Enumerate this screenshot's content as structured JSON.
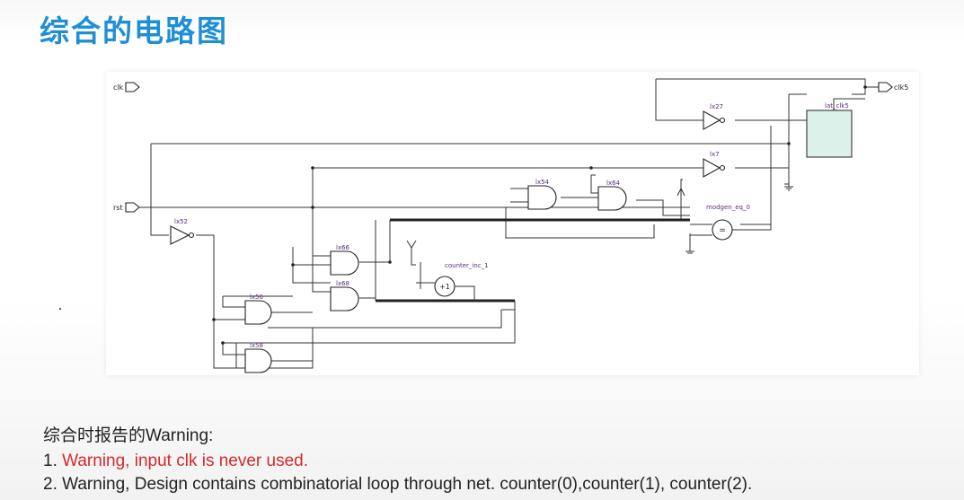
{
  "title": "综合的电路图",
  "diagram": {
    "ports": {
      "clk": "clk",
      "rst": "rst",
      "clk5": "clk5"
    },
    "instances": {
      "Ix27": "lx27",
      "Ix7": "lx7",
      "Ix52": "lx52",
      "Ix54": "lx54",
      "Ix64": "lx64",
      "Ix66": "lx66",
      "Ix68": "lx68",
      "Ix56": "lx56",
      "Ix58": "lx58",
      "lat_clk5": "lat_clk5",
      "counter_inc": "counter_inc_1",
      "modgen": "modgen_eq_0"
    },
    "symbols": {
      "inc": "+1",
      "eq": "="
    }
  },
  "notes": {
    "heading": "综合时报告的Warning:",
    "items": [
      {
        "num": "1.",
        "text": "Warning, input clk is never used."
      },
      {
        "num": "2.",
        "text": "Warning, Design contains combinatorial loop through net.  counter(0),counter(1), counter(2)."
      }
    ]
  },
  "colors": {
    "title": "#1e8fd6",
    "warning": "#d52a2a",
    "latch": "#9ad7c4"
  }
}
